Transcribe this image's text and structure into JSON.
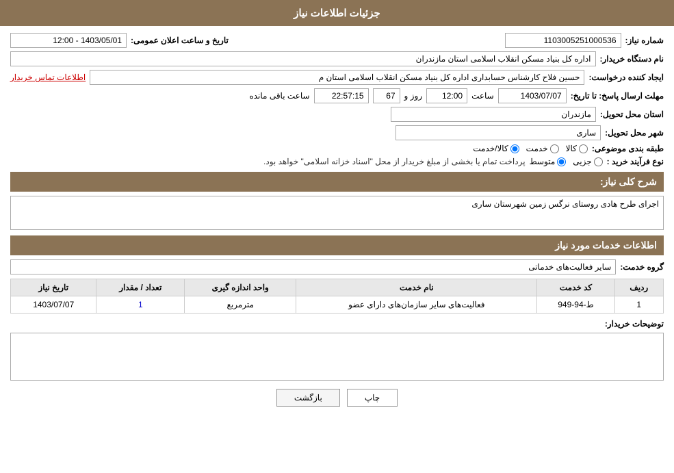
{
  "page": {
    "title": "جزئیات اطلاعات نیاز"
  },
  "header": {
    "title": "جزئیات اطلاعات نیاز"
  },
  "fields": {
    "shomareNiaz_label": "شماره نیاز:",
    "shomareNiaz_value": "1103005251000536",
    "namDastgah_label": "نام دستگاه خریدار:",
    "namDastgah_value": "اداره کل بنیاد مسکن انقلاب اسلامی استان مازندران",
    "ijadKonande_label": "ایجاد کننده درخواست:",
    "ijadKonande_value": "حسین فلاح کارشناس حسابداری اداره کل بنیاد مسکن انقلاب اسلامی استان م",
    "ijadKonande_link": "اطلاعات تماس خریدار",
    "mohlat_label": "مهلت ارسال پاسخ: تا تاریخ:",
    "mohlat_date": "1403/07/07",
    "mohlat_saat_label": "ساعت",
    "mohlat_saat": "12:00",
    "mohlat_roz_label": "روز و",
    "mohlat_roz": "67",
    "mohlat_countdown": "22:57:15",
    "mohlat_remaining_label": "ساعت باقی مانده",
    "ostan_label": "استان محل تحویل:",
    "ostan_value": "مازندران",
    "shahr_label": "شهر محل تحویل:",
    "shahr_value": "ساری",
    "tarighe_label": "طبقه بندی موضوعی:",
    "tarighe_kala": "کالا",
    "tarighe_khadamat": "خدمت",
    "tarighe_kalaKhadamat": "کالا/خدمت",
    "noefarayand_label": "نوع فرآیند خرید :",
    "noefarayand_jozi": "جزیی",
    "noefarayand_motavasset": "متوسط",
    "noefarayand_desc": "پرداخت تمام یا بخشی از مبلغ خریدار از محل \"اسناد خزانه اسلامی\" خواهد بود.",
    "takhlis_label": "شرح کلی نیاز:",
    "takhlis_value": "اجرای طرح هادی روستای نرگس زمین شهرستان ساری",
    "amaliat_label": "اطلاعات خدمات مورد نیاز",
    "grohe_label": "گروه خدمت:",
    "grohe_value": "سایر فعالیت‌های خدماتی",
    "table": {
      "col_radif": "ردیف",
      "col_kod": "کد خدمت",
      "col_name": "نام خدمت",
      "col_unit": "واحد اندازه گیری",
      "col_count": "تعداد / مقدار",
      "col_date": "تاریخ نیاز",
      "rows": [
        {
          "radif": "1",
          "kod": "ط-94-949",
          "name": "فعالیت‌های سایر سازمان‌های دارای عضو",
          "unit": "مترمربع",
          "count": "1",
          "date": "1403/07/07"
        }
      ]
    },
    "tozihat_label": "توضیحات خریدار:",
    "tozihat_value": "",
    "takh_date_label": "تاریخ و ساعت اعلان عمومی:",
    "takh_date_value": "1403/05/01 - 12:00"
  },
  "buttons": {
    "print": "چاپ",
    "back": "بازگشت"
  }
}
